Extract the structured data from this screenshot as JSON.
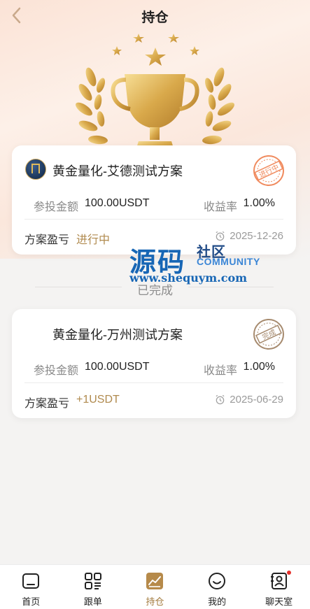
{
  "header": {
    "title": "持仓"
  },
  "section": {
    "completed_label": "已完成"
  },
  "watermark": {
    "main": "源码",
    "side": "社区",
    "community": "COMMUNITY",
    "url": "www.shequym.com"
  },
  "plans": [
    {
      "title": "黄金量化-艾德测试方案",
      "stamp": "进行中",
      "amount_label": "参投金额",
      "amount_value": "100.00USDT",
      "rate_label": "收益率",
      "rate_value": "1.00%",
      "profit_label": "方案盈亏",
      "profit_value": "进行中",
      "date": "2025-12-26",
      "stamp_color": "#f08a5d"
    },
    {
      "title": "黄金量化-万州测试方案",
      "stamp": "完成",
      "amount_label": "参投金额",
      "amount_value": "100.00USDT",
      "rate_label": "收益率",
      "rate_value": "1.00%",
      "profit_label": "方案盈亏",
      "profit_value": "+1USDT",
      "date": "2025-06-29",
      "stamp_color": "#a68a6e"
    }
  ],
  "tabbar": {
    "items": [
      {
        "label": "首页",
        "icon": "home-icon"
      },
      {
        "label": "跟单",
        "icon": "grid-icon"
      },
      {
        "label": "持仓",
        "icon": "chart-icon",
        "active": true
      },
      {
        "label": "我的",
        "icon": "smile-icon"
      },
      {
        "label": "聊天室",
        "icon": "chat-icon",
        "badge": true
      }
    ]
  },
  "colors": {
    "accent": "#a27a3c",
    "background": "#f4f3f2",
    "badge": "#e5322d"
  }
}
